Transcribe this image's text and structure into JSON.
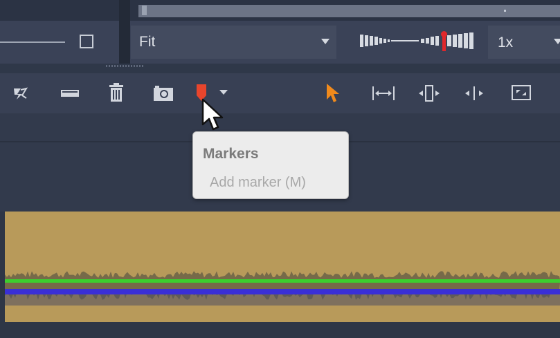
{
  "view": {
    "fit_label": "Fit",
    "speed_label": "1x"
  },
  "toolbar": {
    "tools": [
      "scissors-split-icon",
      "razor-icon",
      "trash-icon",
      "snapshot-camera-icon",
      "marker-icon",
      "dropdown-arrow-icon",
      "pointer-icon",
      "ripple-trim-icon",
      "rolling-edit-icon",
      "slip-icon",
      "slide-icon"
    ]
  },
  "tooltip": {
    "title": "Markers",
    "body": "Add marker (M)"
  },
  "colors": {
    "marker": "#e8452c",
    "pointer": "#f08a1c",
    "audio_clip": "#b89a5a",
    "green_line": "#3ccf2e",
    "blue_line": "#3a2fd6"
  }
}
